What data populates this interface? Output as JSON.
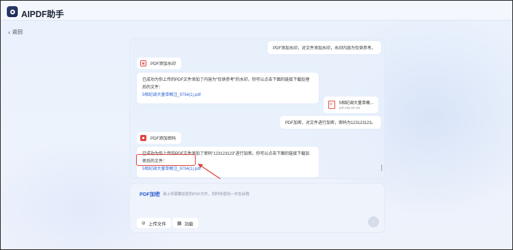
{
  "app": {
    "title": "AIPDF助手"
  },
  "nav": {
    "back_label": "返回"
  },
  "chat": {
    "msg_user_1": "PDF添加水印，对文件添加水印，水印内容为仅供参考。",
    "action_watermark": "PDF添加水印",
    "reply_watermark_text": "已成功为你上传的PDF文件添加了内容为\"仅供参考\"的水印，你可以点击下面的链接下载处理后的文件：",
    "reply_watermark_link": "5相纪调大量单概注_9754(1).pdf",
    "file_name": "5相纪调大量单概...",
    "file_size": "pdf·296.68 KB",
    "msg_user_2": "PDF加密，对文件进行加密，密码为123123123。",
    "action_encrypt": "PDF添加密码",
    "reply_encrypt_text": "已成功为你上传的PDF文件添加了密码\"123123123\"进行加密。你可以点击下面的链接下载加密后的文件：",
    "reply_encrypt_link": "5相纪调大量单概注_9754(1).pdf"
  },
  "composer": {
    "mode_label": "PDF加密",
    "hint": "请上传需要加密的PDF文件，同时传密码一并告诉我",
    "upload_label": "上传文件",
    "features_label": "功能"
  },
  "icons": {
    "logo": "app-logo-icon",
    "back": "chevron-left-icon",
    "watermark": "watermark-icon",
    "lock": "lock-icon",
    "pdf": "pdf-file-icon",
    "upload": "paperclip-icon",
    "features": "grid-icon",
    "send": "send-arrow-icon"
  },
  "colors": {
    "accent": "#2d5fd1",
    "link": "#2d63d6",
    "highlight": "#e23a3a"
  }
}
